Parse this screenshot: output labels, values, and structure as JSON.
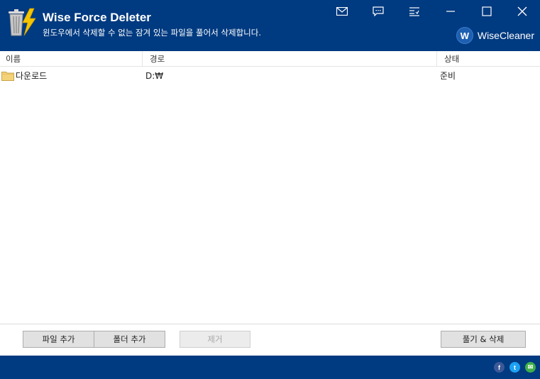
{
  "app": {
    "title": "Wise Force Deleter",
    "subtitle": "윈도우에서 삭제할 수 없는 잠겨 있는 파일을 풀어서 삭제합니다.",
    "brand": "WiseCleaner",
    "brand_badge": "W"
  },
  "titlebar_icons": [
    "mail-icon",
    "feedback-icon",
    "menu-icon",
    "minimize-icon",
    "maximize-icon",
    "close-icon"
  ],
  "table": {
    "columns": {
      "name": "이름",
      "path": "경로",
      "status": "상태"
    },
    "rows": [
      {
        "name": "다운로드",
        "path": "D:₩",
        "status": "준비"
      }
    ]
  },
  "buttons": {
    "add_file": "파일 추가",
    "add_folder": "폴더 추가",
    "remove": "제거",
    "unlock_delete": "풀기 & 삭제"
  },
  "footer": {
    "facebook": "f",
    "twitter": "t",
    "email": "✉"
  },
  "colors": {
    "accent": "#003a80",
    "facebook": "#3b5998",
    "twitter": "#1da1f2",
    "email": "#3fae49"
  }
}
